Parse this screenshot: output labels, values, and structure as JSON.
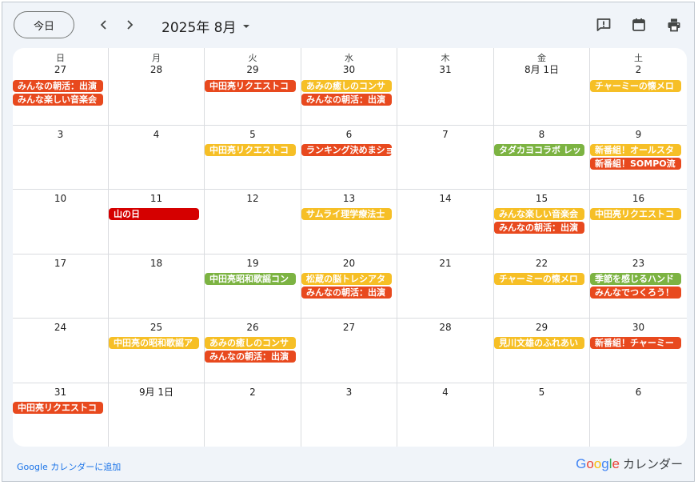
{
  "toolbar": {
    "today_label": "今日",
    "month_label": "2025年 8月"
  },
  "weekdays": [
    "日",
    "月",
    "火",
    "水",
    "木",
    "金",
    "土"
  ],
  "weeks": [
    {
      "days": [
        {
          "date": "27",
          "events": [
            {
              "title": "みんなの朝活：出演",
              "color": "orange"
            },
            {
              "title": "みんな楽しい音楽会",
              "color": "orange"
            }
          ]
        },
        {
          "date": "28",
          "events": []
        },
        {
          "date": "29",
          "events": [
            {
              "title": "中田亮リクエストコ",
              "color": "orange"
            }
          ]
        },
        {
          "date": "30",
          "events": [
            {
              "title": "あみの癒しのコンサ",
              "color": "yellow"
            },
            {
              "title": "みんなの朝活：出演",
              "color": "orange"
            }
          ]
        },
        {
          "date": "31",
          "events": []
        },
        {
          "date": "8月 1日",
          "events": []
        },
        {
          "date": "2",
          "events": [
            {
              "title": "チャーミーの懐メロ",
              "color": "yellow"
            }
          ]
        }
      ]
    },
    {
      "days": [
        {
          "date": "3",
          "events": []
        },
        {
          "date": "4",
          "events": []
        },
        {
          "date": "5",
          "events": [
            {
              "title": "中田亮リクエストコ",
              "color": "yellow"
            }
          ]
        },
        {
          "date": "6",
          "events": [
            {
              "title": "ランキング決めまショ",
              "color": "orange"
            }
          ]
        },
        {
          "date": "7",
          "events": []
        },
        {
          "date": "8",
          "events": [
            {
              "title": "タダカヨコラボ レッ",
              "color": "green"
            }
          ]
        },
        {
          "date": "9",
          "events": [
            {
              "title": "新番組！オールスタ",
              "color": "yellow"
            },
            {
              "title": "新番組！SOMPO流",
              "color": "orange"
            }
          ]
        }
      ]
    },
    {
      "days": [
        {
          "date": "10",
          "events": []
        },
        {
          "date": "11",
          "events": [
            {
              "title": "山の日",
              "color": "red"
            }
          ]
        },
        {
          "date": "12",
          "events": []
        },
        {
          "date": "13",
          "events": [
            {
              "title": "サムライ理学療法士",
              "color": "yellow"
            }
          ]
        },
        {
          "date": "14",
          "events": []
        },
        {
          "date": "15",
          "events": [
            {
              "title": "みんな楽しい音楽会",
              "color": "yellow"
            },
            {
              "title": "みんなの朝活：出演",
              "color": "orange"
            }
          ]
        },
        {
          "date": "16",
          "events": [
            {
              "title": "中田亮リクエストコ",
              "color": "yellow"
            }
          ]
        }
      ]
    },
    {
      "days": [
        {
          "date": "17",
          "events": []
        },
        {
          "date": "18",
          "events": []
        },
        {
          "date": "19",
          "events": [
            {
              "title": "中田亮昭和歌謡コン",
              "color": "green"
            }
          ]
        },
        {
          "date": "20",
          "events": [
            {
              "title": "松蔵の脳トレシアタ",
              "color": "yellow"
            },
            {
              "title": "みんなの朝活：出演",
              "color": "orange"
            }
          ]
        },
        {
          "date": "21",
          "events": []
        },
        {
          "date": "22",
          "events": [
            {
              "title": "チャーミーの懐メロ",
              "color": "yellow"
            }
          ]
        },
        {
          "date": "23",
          "events": [
            {
              "title": "季節を感じるハンド",
              "color": "green"
            },
            {
              "title": "みんなでつくろう！",
              "color": "orange"
            }
          ]
        }
      ]
    },
    {
      "days": [
        {
          "date": "24",
          "events": []
        },
        {
          "date": "25",
          "events": [
            {
              "title": "中田亮の昭和歌謡ア",
              "color": "yellow"
            }
          ]
        },
        {
          "date": "26",
          "events": [
            {
              "title": "あみの癒しのコンサ",
              "color": "yellow"
            },
            {
              "title": "みんなの朝活：出演",
              "color": "orange"
            }
          ]
        },
        {
          "date": "27",
          "events": []
        },
        {
          "date": "28",
          "events": []
        },
        {
          "date": "29",
          "events": [
            {
              "title": "見川文雄のふれあい",
              "color": "yellow"
            }
          ]
        },
        {
          "date": "30",
          "events": [
            {
              "title": "新番組！チャーミー",
              "color": "orange"
            }
          ]
        }
      ]
    },
    {
      "days": [
        {
          "date": "31",
          "events": [
            {
              "title": "中田亮リクエストコ",
              "color": "orange"
            }
          ]
        },
        {
          "date": "9月 1日",
          "events": []
        },
        {
          "date": "2",
          "events": []
        },
        {
          "date": "3",
          "events": []
        },
        {
          "date": "4",
          "events": []
        },
        {
          "date": "5",
          "events": []
        },
        {
          "date": "6",
          "events": []
        }
      ]
    }
  ],
  "footer": {
    "add_link": "Google カレンダーに追加",
    "brand_google": [
      "G",
      "o",
      "o",
      "g",
      "l",
      "e"
    ],
    "brand_google_colors": [
      "#4285f4",
      "#ea4335",
      "#fbbc05",
      "#4285f4",
      "#34a853",
      "#ea4335"
    ],
    "brand_suffix": "カレンダー"
  },
  "colors": {
    "orange": "#e8491e",
    "yellow": "#f6bf26",
    "green": "#7cb342",
    "red": "#d50000"
  },
  "icons": [
    "chevron-left-icon",
    "chevron-right-icon",
    "caret-down-icon",
    "feedback-icon",
    "calendar-icon",
    "print-icon"
  ]
}
